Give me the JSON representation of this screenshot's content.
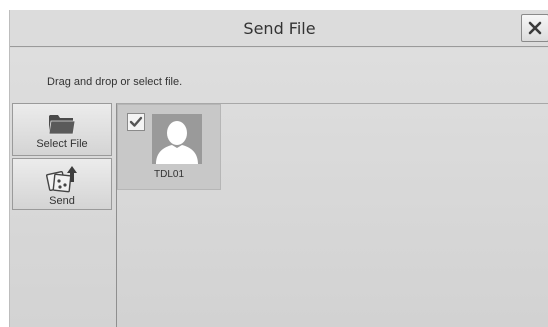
{
  "window": {
    "title": "Send File"
  },
  "instruction": "Drag and drop or select file.",
  "side_buttons": [
    {
      "label": "Select File",
      "icon": "folder-icon"
    },
    {
      "label": "Send",
      "icon": "send-files-icon"
    }
  ],
  "files": [
    {
      "name": "TDL01",
      "checked": true,
      "icon": "user-avatar-icon"
    }
  ],
  "colors": {
    "background": "#d9d9d9",
    "border": "#9a9a9a",
    "icon_dark": "#444444"
  }
}
